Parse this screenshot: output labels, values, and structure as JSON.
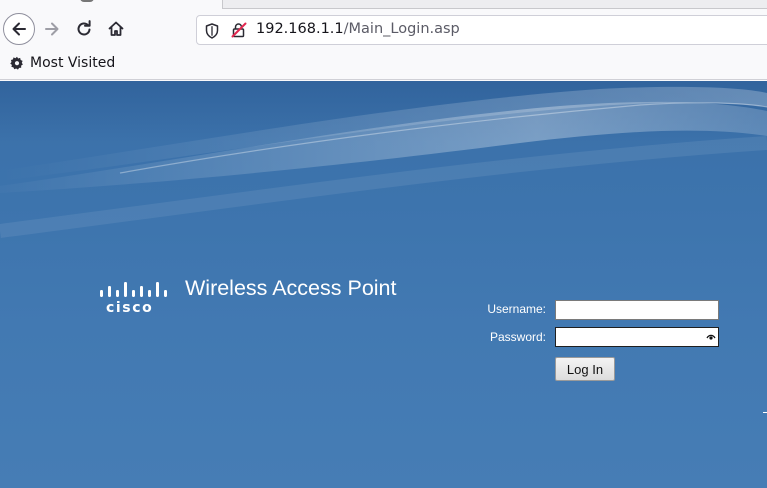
{
  "browser": {
    "url_host": "192.168.1.1",
    "url_path": "/Main_Login.asp",
    "icons": [
      "back-arrow-icon",
      "forward-arrow-icon",
      "reload-icon",
      "home-icon",
      "shield-icon",
      "insecure-lock-icon",
      "gear-icon"
    ],
    "bookmarks": [
      {
        "label": "Most Visited",
        "icon": "gear-icon"
      }
    ]
  },
  "page": {
    "brand": "cisco",
    "title": "Wireless Access Point",
    "form": {
      "username_label": "Username:",
      "password_label": "Password:",
      "username_value": "",
      "password_value": "",
      "login_label": "Log In"
    },
    "colors": {
      "background": "#3f76af",
      "text": "#ffffff"
    }
  }
}
